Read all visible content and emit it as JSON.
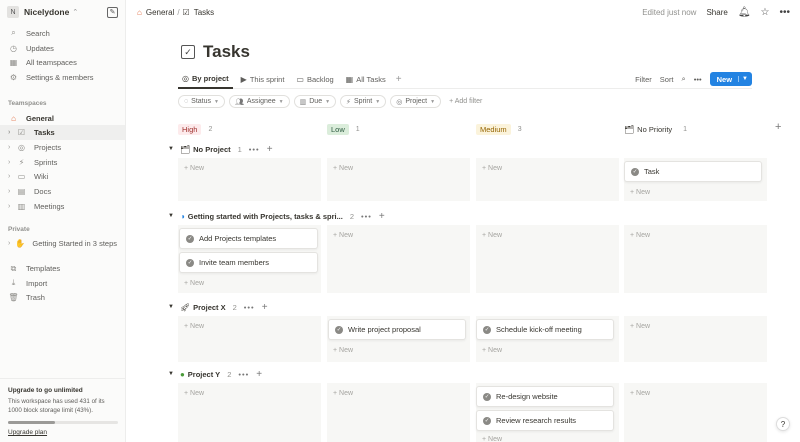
{
  "sidebar": {
    "workspace_initial": "N",
    "workspace_name": "Nicelydone",
    "nav": [
      "Search",
      "Updates",
      "All teamspaces",
      "Settings & members"
    ],
    "teamspaces_label": "Teamspaces",
    "teamspace": "General",
    "teamspace_pages": [
      "Tasks",
      "Projects",
      "Sprints",
      "Wiki",
      "Docs",
      "Meetings"
    ],
    "private_label": "Private",
    "private_page": "Getting Started in 3 steps",
    "bottom": [
      "Templates",
      "Import",
      "Trash"
    ],
    "upgrade": {
      "title": "Upgrade to go unlimited",
      "text": "This workspace has used 431 of its 1000 block storage limit (43%).",
      "usage_fraction": 0.43,
      "link": "Upgrade plan"
    }
  },
  "topbar": {
    "crumb_1": "General",
    "crumb_sep": "/",
    "crumb_2": "Tasks",
    "edited": "Edited just now",
    "share": "Share"
  },
  "page": {
    "title": "Tasks"
  },
  "views": {
    "tabs": [
      "By project",
      "This sprint",
      "Backlog",
      "All Tasks"
    ],
    "filter": "Filter",
    "sort": "Sort",
    "new": "New"
  },
  "filters": [
    "Status",
    "Assignee",
    "Due",
    "Sprint",
    "Project"
  ],
  "add_filter": "+ Add filter",
  "columns": [
    {
      "name": "High",
      "count": "2",
      "bg": "#fdebec",
      "fg": "#9f2f2d"
    },
    {
      "name": "Low",
      "count": "1",
      "bg": "#dbeddb",
      "fg": "#2b593f"
    },
    {
      "name": "Medium",
      "count": "3",
      "bg": "#fbf3db",
      "fg": "#956400"
    },
    {
      "name": "No Priority",
      "count": "1",
      "bg": "transparent",
      "fg": "#37352f"
    }
  ],
  "groups": [
    {
      "name": "No Project",
      "count": "1"
    },
    {
      "name": "Getting started with Projects, tasks & spri...",
      "count": "2"
    },
    {
      "name": "Project X",
      "count": "2"
    },
    {
      "name": "Project Y",
      "count": "2"
    }
  ],
  "cards": {
    "task": "Task",
    "add_templates": "Add Projects templates",
    "invite": "Invite team members",
    "write_proposal": "Write project proposal",
    "kickoff": "Schedule kick-off meeting",
    "redesign": "Re-design website",
    "research": "Review research results"
  },
  "new_label": "+ New",
  "help": "?"
}
